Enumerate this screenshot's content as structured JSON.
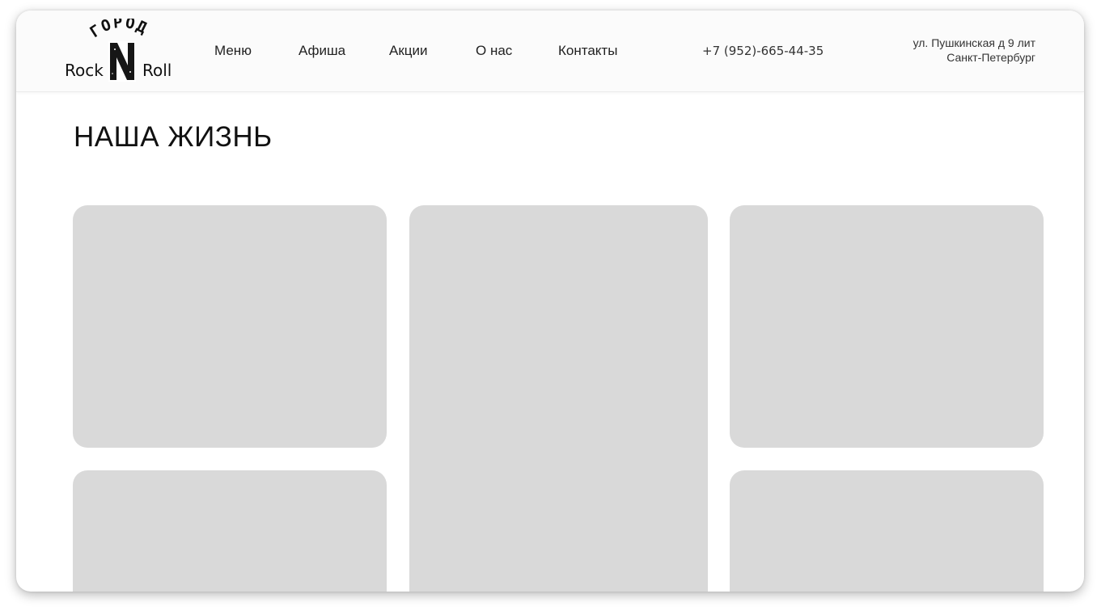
{
  "header": {
    "logo": {
      "top_text": "ГОРОД",
      "left_word": "Rock",
      "center_letter": "N",
      "right_word": "Roll"
    },
    "nav": [
      {
        "label": "Меню"
      },
      {
        "label": "Афиша"
      },
      {
        "label": "Акции"
      },
      {
        "label": "О нас"
      },
      {
        "label": "Контакты"
      }
    ],
    "phone": "+7 (952)-665-44-35",
    "address": {
      "line1": "ул. Пушкинская д 9 лит",
      "line2": "Санкт-Петербург"
    }
  },
  "main": {
    "title": "НАША ЖИЗНЬ",
    "gallery_count": 5
  },
  "colors": {
    "tile": "#d9d9d9",
    "header_bg": "#fbfbfb",
    "text": "#111111"
  }
}
